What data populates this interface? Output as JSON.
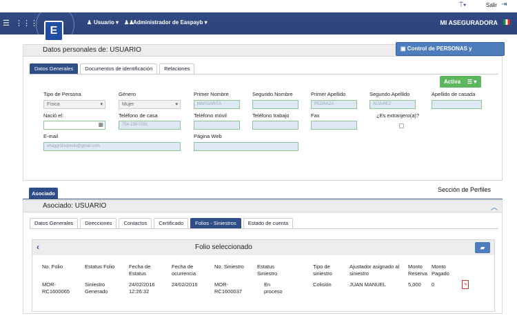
{
  "topbar": {
    "salir": "Salir"
  },
  "navbar": {
    "usuario": "Usuario",
    "admin": "Administrador de Easpayb",
    "brand": "MI ASEGURADORA",
    "logo_letter": "E"
  },
  "personal": {
    "title": "Datos personales de: USUARIO",
    "control_button": "Control de PERSONAS y RELACIONES",
    "tabs": [
      "Datos Generales",
      "Documentos de identificación",
      "Relaciones"
    ],
    "status": "Activa",
    "labels": {
      "tipo": "Tipo de Persona",
      "genero": "Género",
      "primer_nombre": "Primer Nombre",
      "segundo_nombre": "Segundo Nombre",
      "primer_apellido": "Primer Apellido",
      "segundo_apellido": "Segundo Apellido",
      "apellido_casada": "Apellido de casada",
      "nacio": "Nació el:",
      "tel_casa": "Teléfono de casa",
      "tel_movil": "Teléfono móvil",
      "tel_trabajo": "Teléfono trabajo",
      "fax": "Fax",
      "extranjero": "¿Es extranjero(a)?",
      "email": "E-mail",
      "web": "Página Web"
    },
    "values": {
      "tipo": "Física",
      "genero": "Mujer",
      "primer_nombre": "MARGARITA",
      "primer_apellido": "PEDRAZA",
      "segundo_apellido": "ALVAREZ",
      "tel_casa": "756-159-0301",
      "email": "ahaggr1loopeda@gmail.com"
    }
  },
  "asociado": {
    "tab": "Asociado",
    "seccion": "Sección de Perfiles",
    "title": "Asociado: USUARIO",
    "tabs": [
      "Datos Generales",
      "Direcciones",
      "Contactos",
      "Certificado",
      "Folios - Siniestros",
      "Estado de cuenta"
    ],
    "folio_title": "Folio seleccionado",
    "headers": [
      "No. Folio",
      "Estatus Folio",
      "Fecha de Estatus",
      "Fecha de ocurrencia",
      "No. Siniestro",
      "Estatus Siniestro",
      "Tipo de siniestro",
      "Ajustador asignado al siniestro",
      "Monto Reserva",
      "Monto Pagado"
    ],
    "row": {
      "folio": "MOR-RC1600065",
      "estatus": "Siniestro Generado",
      "fecha_estatus": "24/02/2016 12:26:32",
      "fecha_ocurrencia": "24/02/2016",
      "siniestro": "MOR-RC1600037",
      "estatus_siniestro": "En proceso",
      "tipo": "Colisión",
      "ajustador": "JUAN MANUEL",
      "reserva": "5,000",
      "pagado": "0"
    }
  }
}
